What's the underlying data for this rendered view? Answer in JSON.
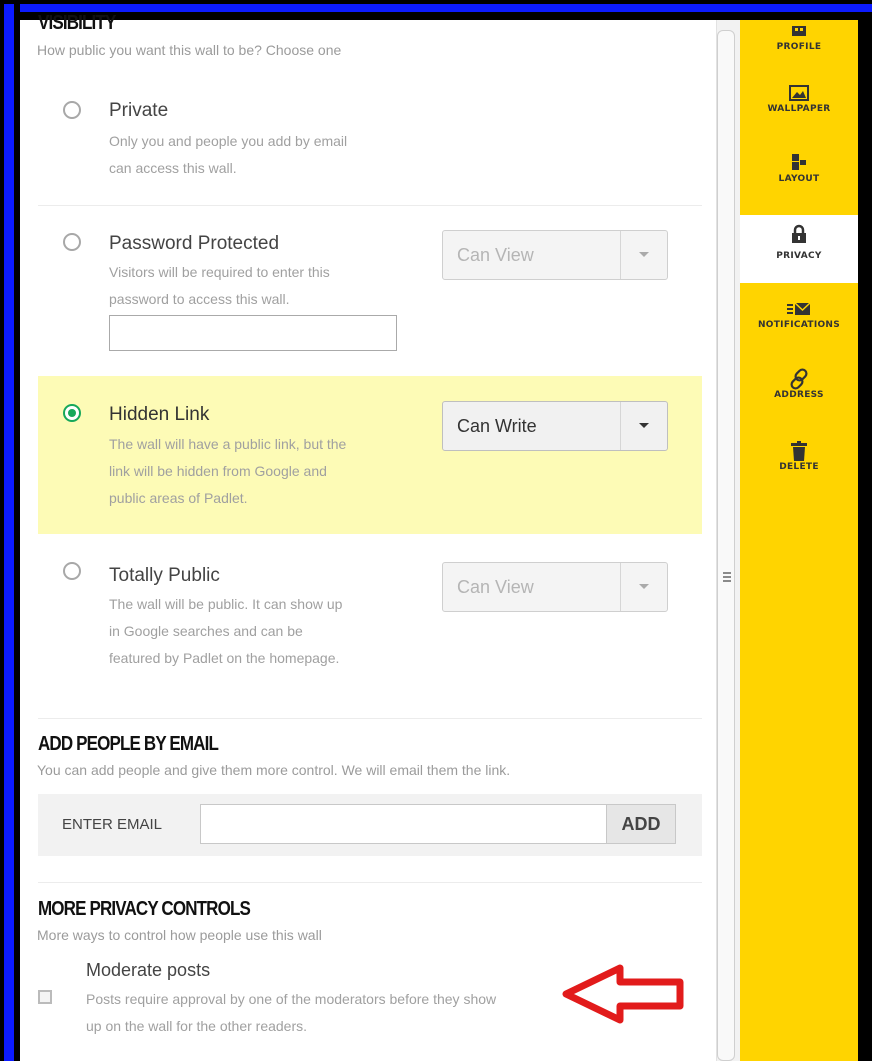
{
  "visibility": {
    "title": "VISIBILITY",
    "subtitle": "How public you want this wall to be? Choose one",
    "options": [
      {
        "label": "Private",
        "desc1": "Only you and people you add by email",
        "desc2": "can access this wall.",
        "desc3": "",
        "selected": false
      },
      {
        "label": "Password Protected",
        "desc1": "Visitors will be required to enter this",
        "desc2": "password to access this wall.",
        "desc3": "",
        "selected": false,
        "dropdown": "Can View"
      },
      {
        "label": "Hidden Link",
        "desc1": "The wall will have a public link, but the",
        "desc2": "link will be hidden from Google and",
        "desc3": "public areas of Padlet.",
        "selected": true,
        "dropdown": "Can Write"
      },
      {
        "label": "Totally Public",
        "desc1": "The wall will be public. It can show up",
        "desc2": "in Google searches and can be",
        "desc3": "featured by Padlet on the homepage.",
        "selected": false,
        "dropdown": "Can View"
      }
    ]
  },
  "add_people": {
    "title": "ADD PEOPLE BY EMAIL",
    "subtitle": "You can add people and give them more control. We will email them the link.",
    "field_label": "ENTER EMAIL",
    "email_value": "",
    "button_label": "ADD"
  },
  "more_privacy": {
    "title": "MORE PRIVACY CONTROLS",
    "subtitle": "More ways to control how people use this wall",
    "moderate_label": "Moderate posts",
    "moderate_desc1": "Posts require approval by one of the moderators before they show",
    "moderate_desc2": "up on the wall for the other readers.",
    "moderate_checked": false
  },
  "sidebar": {
    "items": [
      {
        "label": "PROFILE",
        "icon": "profile-icon"
      },
      {
        "label": "WALLPAPER",
        "icon": "wallpaper-icon"
      },
      {
        "label": "LAYOUT",
        "icon": "layout-icon"
      },
      {
        "label": "PRIVACY",
        "icon": "lock-icon",
        "active": true
      },
      {
        "label": "NOTIFICATIONS",
        "icon": "envelope-icon"
      },
      {
        "label": "ADDRESS",
        "icon": "link-icon"
      },
      {
        "label": "DELETE",
        "icon": "trash-icon"
      }
    ]
  },
  "colors": {
    "sidebar_bg": "#ffd400",
    "highlight_bg": "#fdfbb6",
    "radio_selected": "#17a85a",
    "arrow": "#e21b1b",
    "frame": "#0c1bff"
  }
}
